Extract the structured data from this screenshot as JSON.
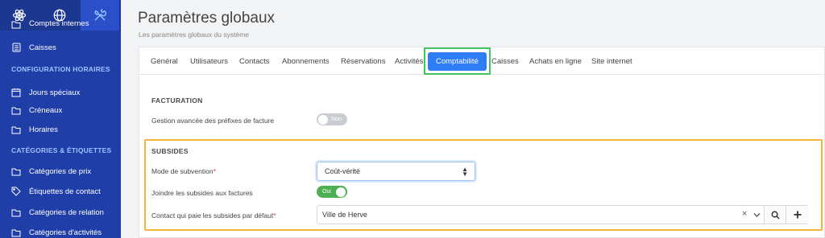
{
  "sidebar": {
    "items": [
      {
        "label": "Comptes internes",
        "icon": "folder-icon"
      },
      {
        "label": "Caisses",
        "icon": "register-icon"
      },
      {
        "label": "Jours spéciaux",
        "icon": "calendar-icon"
      },
      {
        "label": "Créneaux",
        "icon": "folder-icon"
      },
      {
        "label": "Horaires",
        "icon": "folder-icon"
      },
      {
        "label": "Catégories de prix",
        "icon": "folder-icon"
      },
      {
        "label": "Étiquettes de contact",
        "icon": "tag-icon"
      },
      {
        "label": "Catégories de relation",
        "icon": "folder-icon"
      },
      {
        "label": "Catégories d'activités",
        "icon": "folder-icon"
      }
    ],
    "sections": {
      "horaires": "CONFIGURATION HORAIRES",
      "categories": "CATÉGORIES & ÉTIQUETTES"
    }
  },
  "header": {
    "title": "Paramètres globaux",
    "subtitle": "Les paramètres globaux du système"
  },
  "tabs": [
    {
      "label": "Général"
    },
    {
      "label": "Utilisateurs"
    },
    {
      "label": "Contacts"
    },
    {
      "label": "Abonnements"
    },
    {
      "label": "Réservations"
    },
    {
      "label": "Activités"
    },
    {
      "label": "Comptabilité",
      "active": true
    },
    {
      "label": "Caisses"
    },
    {
      "label": "Achats en ligne"
    },
    {
      "label": "Site internet"
    }
  ],
  "facturation": {
    "title": "FACTURATION",
    "prefix_label": "Gestion avancée des préfixes de facture",
    "prefix_toggle": "Non"
  },
  "subsides": {
    "title": "SUBSIDES",
    "mode_label": "Mode de subvention",
    "mode_required": "*",
    "mode_value": "Coût-vérité",
    "join_label": "Joindre les subsides aux factures",
    "join_toggle": "Oui",
    "contact_label": "Contact qui paie les subsides par défaut",
    "contact_required": "*",
    "contact_value": "Ville de Herve"
  },
  "colors": {
    "sidebar": "#1f3ea8",
    "accent": "#2e7cf6",
    "highlight_green": "#43c463",
    "highlight_orange": "#f2b53a",
    "toggle_on": "#4caf50"
  }
}
